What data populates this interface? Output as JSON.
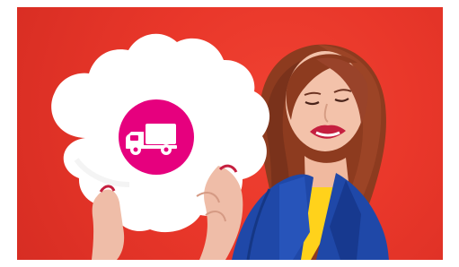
{
  "image": {
    "background_color": "#e73a2d",
    "frame_color": "#ffffff",
    "badge_color": "#e6007e",
    "cloud_color": "#ffffff",
    "jacket_color": "#1f48a8",
    "top_color": "#ffd21b",
    "hair_color": "#8d3b1f",
    "icon": "delivery-truck-icon"
  }
}
